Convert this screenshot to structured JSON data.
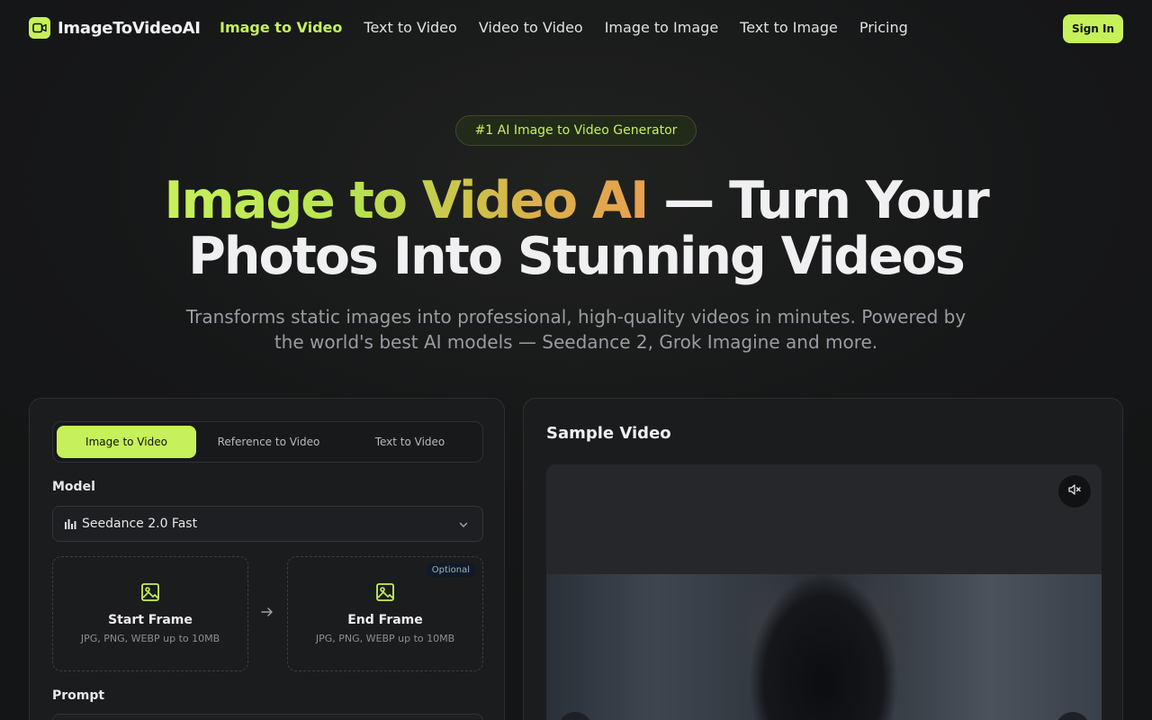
{
  "header": {
    "logo_text": "ImageToVideoAI",
    "nav": [
      {
        "label": "Image to Video",
        "active": true
      },
      {
        "label": "Text to Video"
      },
      {
        "label": "Video to Video"
      },
      {
        "label": "Image to Image"
      },
      {
        "label": "Text to Image"
      },
      {
        "label": "Pricing"
      }
    ],
    "signin_label": "Sign In"
  },
  "hero": {
    "badge": "#1 AI Image to Video Generator",
    "title_highlight": "Image to Video AI",
    "title_rest_1": " — Turn Your",
    "title_rest_2": "Photos Into Stunning Videos",
    "subtitle": "Transforms static images into professional, high-quality videos in minutes. Powered by the world's best AI models — Seedance 2, Grok Imagine and more."
  },
  "generator": {
    "tabs": [
      {
        "label": "Image to Video",
        "active": true
      },
      {
        "label": "Reference to Video"
      },
      {
        "label": "Text to Video"
      }
    ],
    "model_label": "Model",
    "model_value": "Seedance 2.0 Fast",
    "start_frame": {
      "title": "Start Frame",
      "hint": "JPG, PNG, WEBP up to 10MB"
    },
    "end_frame": {
      "title": "End Frame",
      "hint": "JPG, PNG, WEBP up to 10MB",
      "badge": "Optional"
    },
    "prompt_label": "Prompt"
  },
  "sample": {
    "title": "Sample Video"
  },
  "colors": {
    "accent": "#c6f15a",
    "background": "#161718",
    "panel": "#1b1c1e"
  }
}
